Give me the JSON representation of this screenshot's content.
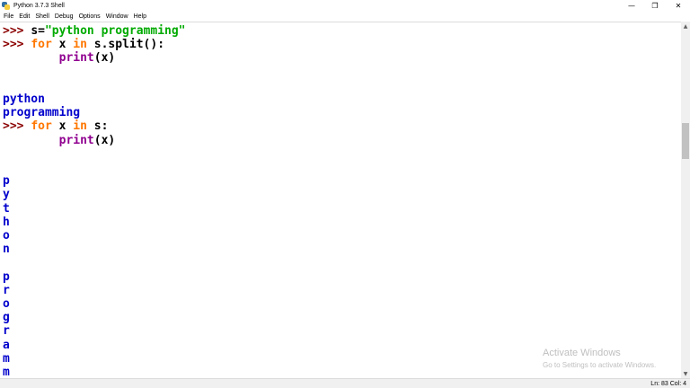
{
  "window": {
    "title": "Python 3.7.3 Shell",
    "controls": {
      "minimize": "—",
      "restore": "❐",
      "close": "✕"
    }
  },
  "menu": {
    "items": [
      "File",
      "Edit",
      "Shell",
      "Debug",
      "Options",
      "Window",
      "Help"
    ]
  },
  "shell": {
    "prompt": ">>>",
    "lines": [
      {
        "kind": "code",
        "segments": [
          {
            "text": ">>> ",
            "cls": "prompt"
          },
          {
            "text": "s=",
            "cls": "plain"
          },
          {
            "text": "\"python programming\"",
            "cls": "str"
          }
        ]
      },
      {
        "kind": "code",
        "segments": [
          {
            "text": ">>> ",
            "cls": "prompt"
          },
          {
            "text": "for",
            "cls": "kw"
          },
          {
            "text": " x ",
            "cls": "plain"
          },
          {
            "text": "in",
            "cls": "kw"
          },
          {
            "text": " s.split():",
            "cls": "plain"
          }
        ]
      },
      {
        "kind": "code",
        "segments": [
          {
            "text": "        ",
            "cls": "plain"
          },
          {
            "text": "print",
            "cls": "builtin"
          },
          {
            "text": "(x)",
            "cls": "plain"
          }
        ]
      },
      {
        "kind": "blank",
        "segments": []
      },
      {
        "kind": "blank",
        "segments": []
      },
      {
        "kind": "output",
        "segments": [
          {
            "text": "python",
            "cls": "out"
          }
        ]
      },
      {
        "kind": "output",
        "segments": [
          {
            "text": "programming",
            "cls": "out"
          }
        ]
      },
      {
        "kind": "code",
        "segments": [
          {
            "text": ">>> ",
            "cls": "prompt"
          },
          {
            "text": "for",
            "cls": "kw"
          },
          {
            "text": " x ",
            "cls": "plain"
          },
          {
            "text": "in",
            "cls": "kw"
          },
          {
            "text": " s:",
            "cls": "plain"
          }
        ]
      },
      {
        "kind": "code",
        "segments": [
          {
            "text": "        ",
            "cls": "plain"
          },
          {
            "text": "print",
            "cls": "builtin"
          },
          {
            "text": "(x)",
            "cls": "plain"
          }
        ]
      },
      {
        "kind": "blank",
        "segments": []
      },
      {
        "kind": "blank",
        "segments": []
      },
      {
        "kind": "output",
        "segments": [
          {
            "text": "p",
            "cls": "out"
          }
        ]
      },
      {
        "kind": "output",
        "segments": [
          {
            "text": "y",
            "cls": "out"
          }
        ]
      },
      {
        "kind": "output",
        "segments": [
          {
            "text": "t",
            "cls": "out"
          }
        ]
      },
      {
        "kind": "output",
        "segments": [
          {
            "text": "h",
            "cls": "out"
          }
        ]
      },
      {
        "kind": "output",
        "segments": [
          {
            "text": "o",
            "cls": "out"
          }
        ]
      },
      {
        "kind": "output",
        "segments": [
          {
            "text": "n",
            "cls": "out"
          }
        ]
      },
      {
        "kind": "output",
        "segments": [
          {
            "text": " ",
            "cls": "out"
          }
        ]
      },
      {
        "kind": "output",
        "segments": [
          {
            "text": "p",
            "cls": "out"
          }
        ]
      },
      {
        "kind": "output",
        "segments": [
          {
            "text": "r",
            "cls": "out"
          }
        ]
      },
      {
        "kind": "output",
        "segments": [
          {
            "text": "o",
            "cls": "out"
          }
        ]
      },
      {
        "kind": "output",
        "segments": [
          {
            "text": "g",
            "cls": "out"
          }
        ]
      },
      {
        "kind": "output",
        "segments": [
          {
            "text": "r",
            "cls": "out"
          }
        ]
      },
      {
        "kind": "output",
        "segments": [
          {
            "text": "a",
            "cls": "out"
          }
        ]
      },
      {
        "kind": "output",
        "segments": [
          {
            "text": "m",
            "cls": "out"
          }
        ]
      },
      {
        "kind": "output",
        "segments": [
          {
            "text": "m",
            "cls": "out"
          }
        ]
      }
    ]
  },
  "status": {
    "text": "Ln: 83   Col: 4"
  },
  "watermark": {
    "line1": "Activate Windows",
    "line2": "Go to Settings to activate Windows."
  },
  "colors": {
    "prompt": "#8b0000",
    "keyword": "#ff7700",
    "string": "#00aa00",
    "builtin": "#900090",
    "output": "#0000cc"
  },
  "icons": {
    "app": "python-logo-icon",
    "scroll_up": "chevron-up-icon",
    "scroll_down": "chevron-down-icon"
  }
}
